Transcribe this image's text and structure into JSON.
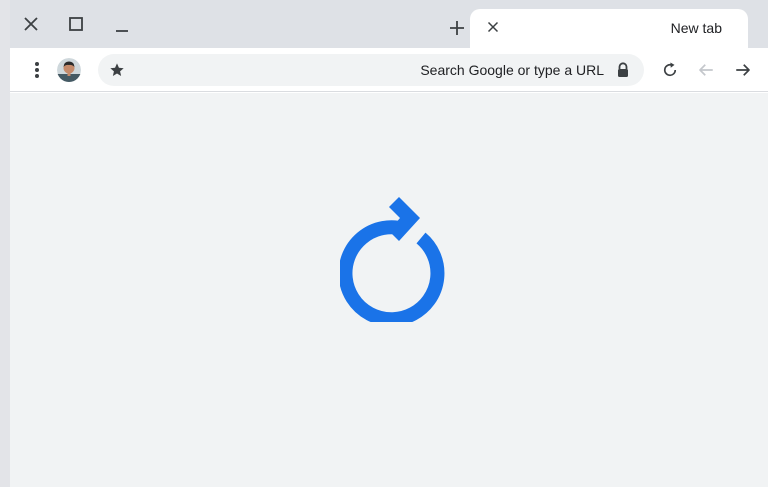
{
  "tab": {
    "title": "New tab",
    "close_icon": "close-icon"
  },
  "titlebar": {
    "new_tab_icon": "plus-icon",
    "minimize_icon": "minimize-icon",
    "maximize_icon": "maximize-icon",
    "close_icon": "close-icon"
  },
  "toolbar": {
    "omnibox_placeholder": "Search Google or type a URL",
    "icons": [
      "menu-dots-icon",
      "avatar",
      "star-icon",
      "lock-icon",
      "reload-icon",
      "back-icon",
      "forward-icon"
    ]
  },
  "content": {
    "icon": "reload-icon"
  },
  "colors": {
    "accent": "#1a73e8",
    "titlebar": "#dee1e6",
    "page_background": "#f1f3f4",
    "icon": "#5f6368"
  }
}
